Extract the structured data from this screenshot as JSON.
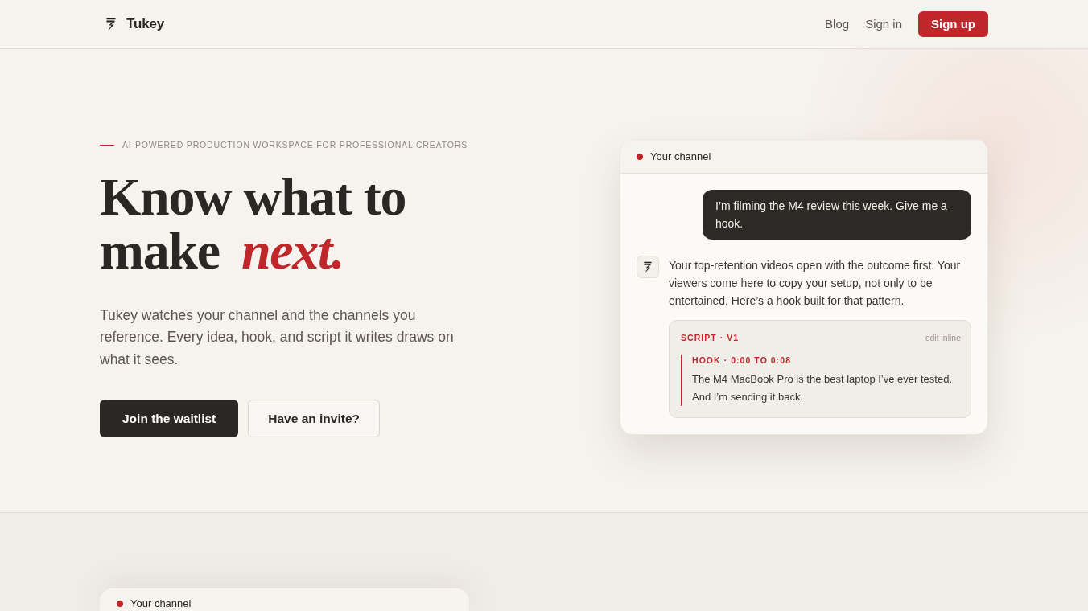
{
  "navbar": {
    "brand": "Tukey",
    "links": [
      "Blog",
      "Sign in"
    ],
    "signup_button": "Sign up"
  },
  "hero": {
    "eyebrow": "AI-POWERED PRODUCTION WORKSPACE FOR PROFESSIONAL CREATORS",
    "headline_lines": [
      "Know what to",
      "make *next.*"
    ],
    "description": "Tukey watches your channel and the channels you reference. Every idea, hook, and script it writes draws on what it sees.",
    "buttons": [
      {
        "label": "Join the waitlist",
        "kind": "primary"
      },
      {
        "label": "Have an invite?",
        "kind": "outline"
      }
    ]
  },
  "chat_preview": {
    "channel_label": "Your channel",
    "messages": [
      {
        "kind": "user",
        "text": "I’m filming the M4 review this week. Give me a hook."
      },
      {
        "kind": "assistant",
        "text": "Your top-retention videos open with the outcome first. Your viewers come here to copy your setup, not only to be entertained. Here’s a hook built for that pattern."
      }
    ],
    "script": {
      "label": "SCRIPT · V1",
      "action": "edit inline",
      "section_label": "HOOK · 0:00 TO 0:08",
      "text": "The M4 MacBook Pro is the best laptop I’ve ever tested. And I’m sending it back."
    }
  },
  "second_section": {
    "card": {
      "channel_label": "Your channel"
    }
  }
}
